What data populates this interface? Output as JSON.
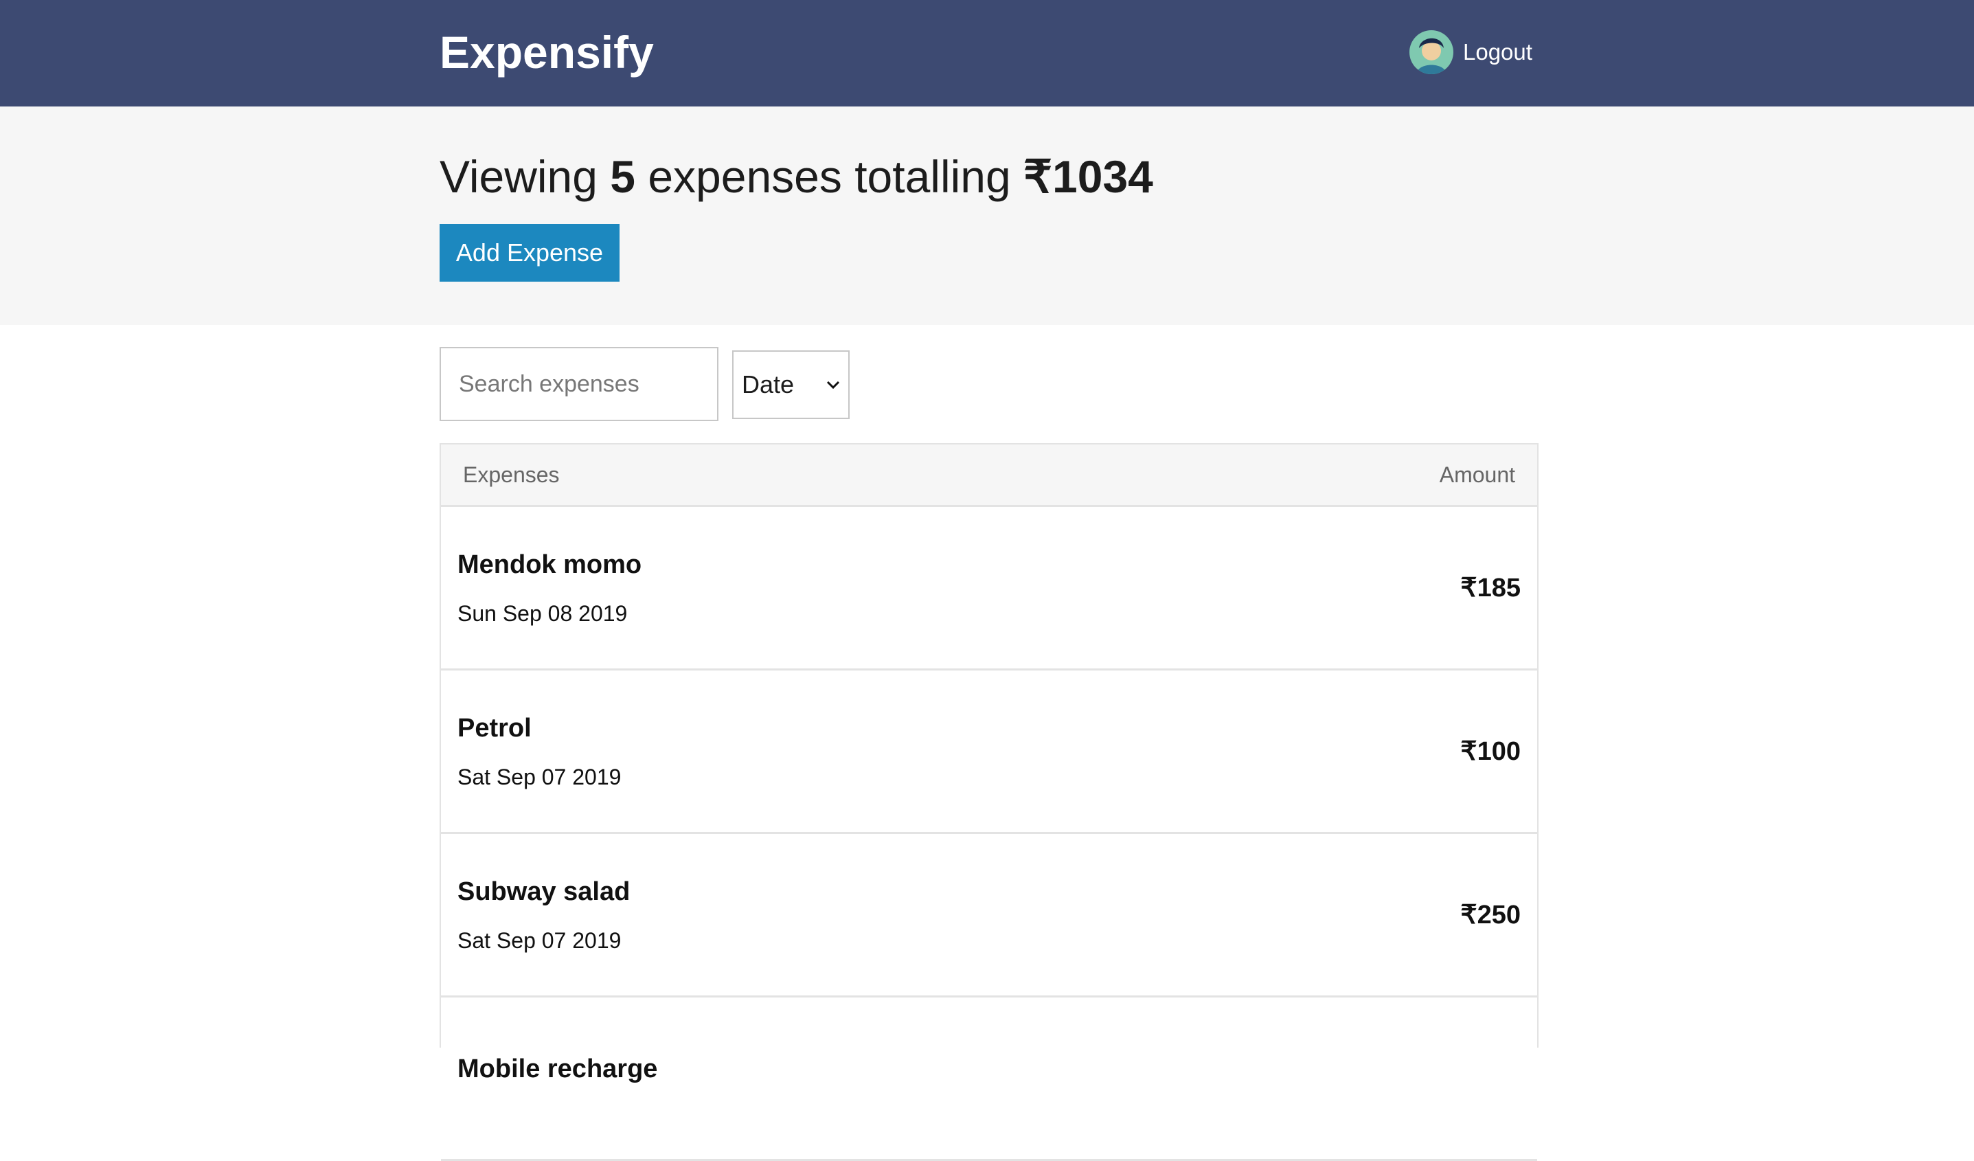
{
  "header": {
    "brand": "Expensify",
    "logout_label": "Logout",
    "avatar_icon": "user-avatar"
  },
  "summary": {
    "prefix": "Viewing",
    "count": "5",
    "middle": "expenses totalling",
    "total": "₹1034",
    "add_button_label": "Add Expense"
  },
  "filters": {
    "search_placeholder": "Search expenses",
    "search_value": "",
    "sort_selected": "Date"
  },
  "table": {
    "columns": [
      "Expenses",
      "Amount"
    ],
    "rows": [
      {
        "title": "Mendok momo",
        "date": "Sun Sep 08 2019",
        "amount": "₹185"
      },
      {
        "title": "Petrol",
        "date": "Sat Sep 07 2019",
        "amount": "₹100"
      },
      {
        "title": "Subway salad",
        "date": "Sat Sep 07 2019",
        "amount": "₹250"
      },
      {
        "title": "Mobile recharge",
        "date": "",
        "amount": ""
      }
    ]
  },
  "colors": {
    "header_bg": "#3d4a72",
    "button_bg": "#1c88bf",
    "summary_bg": "#f6f6f6"
  }
}
